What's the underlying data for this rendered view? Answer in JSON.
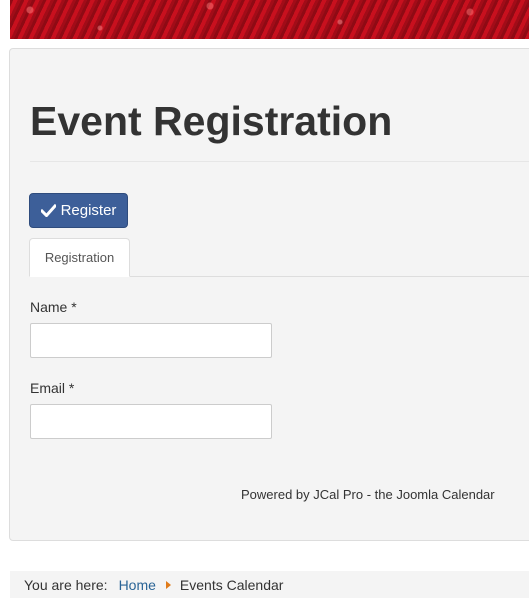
{
  "header": {
    "banner_image": "red-flowers-banner"
  },
  "page": {
    "title": "Event Registration"
  },
  "actions": {
    "register_label": "Register",
    "register_icon": "checkmark-icon"
  },
  "tabs": [
    {
      "label": "Registration",
      "active": true
    }
  ],
  "form": {
    "name_label": "Name *",
    "name_value": "",
    "email_label": "Email *",
    "email_value": ""
  },
  "footer": {
    "powered_by": "Powered by JCal Pro - the Joomla Calendar"
  },
  "breadcrumb": {
    "prefix": "You are here:",
    "items": [
      {
        "label": "Home",
        "link": true
      },
      {
        "label": "Events Calendar",
        "link": false
      }
    ],
    "separator_icon": "triangle-right-icon"
  },
  "colors": {
    "primary_button": "#3d5f99",
    "link": "#2a6496",
    "separator": "#e07b1a",
    "panel_bg": "#f4f4f4"
  }
}
